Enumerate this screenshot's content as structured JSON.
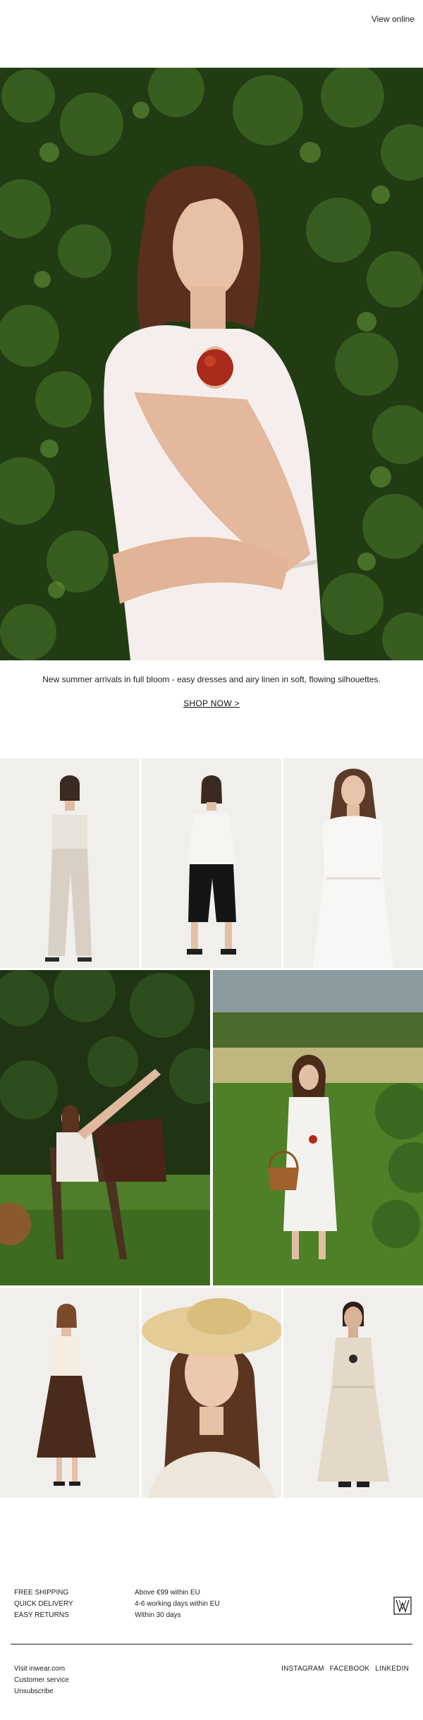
{
  "header": {
    "view_online": "View online"
  },
  "hero": {
    "alt": "Woman in white sleeveless dress holding a red apple in front of a green hedge"
  },
  "intro": {
    "tagline": "New summer arrivals in full bloom - easy dresses and airy linen in soft, flowing silhouettes.",
    "cta": "SHOP NOW >"
  },
  "footer": {
    "perks": [
      "FREE SHIPPING",
      "QUICK DELIVERY",
      "EASY RETURNS"
    ],
    "perk_details": [
      "Above €99 within EU",
      "4-6 working days within EU",
      "Within 30 days"
    ],
    "links": [
      "Visit inwear.com",
      "Customer service",
      "Unsubscribe"
    ],
    "social": [
      "INSTAGRAM",
      "FACEBOOK",
      "LINKEDIN"
    ]
  },
  "colors": {
    "foliage": "#2c4a1c",
    "studio_bg": "#f3f1ee",
    "text": "#1a1a1a"
  }
}
